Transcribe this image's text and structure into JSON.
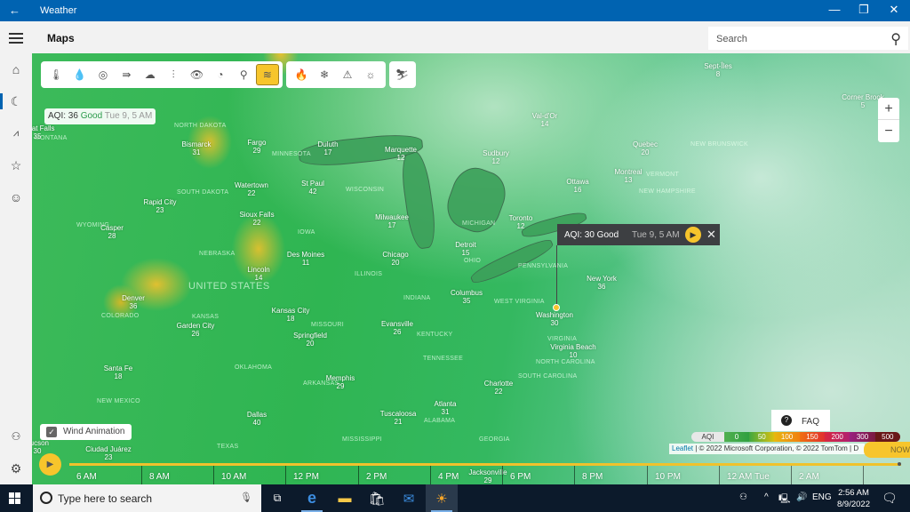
{
  "window": {
    "title": "Weather",
    "back_icon": "←",
    "minimize": "—",
    "restore": "❐",
    "close": "✕"
  },
  "header": {
    "page_title": "Maps",
    "search_placeholder": "Search"
  },
  "leftnav": {
    "items": [
      {
        "name": "home",
        "icon": "⌂"
      },
      {
        "name": "maps",
        "icon": "☾",
        "selected": true
      },
      {
        "name": "historical-weather",
        "icon": "📈"
      },
      {
        "name": "favorite-places",
        "icon": "☆"
      },
      {
        "name": "life",
        "icon": "☺"
      }
    ],
    "bottom": [
      {
        "name": "account",
        "icon": "👤"
      },
      {
        "name": "settings",
        "icon": "⚙"
      }
    ]
  },
  "toolbar": {
    "group1": [
      {
        "name": "temperature",
        "icon": "🌡"
      },
      {
        "name": "precipitation",
        "icon": "💧"
      },
      {
        "name": "radar",
        "icon": "◎"
      },
      {
        "name": "wind",
        "icon": "⇛"
      },
      {
        "name": "cloud",
        "icon": "☁"
      },
      {
        "name": "humidity",
        "icon": "⫶💧"
      },
      {
        "name": "visibility",
        "icon": "👁"
      },
      {
        "name": "pressure",
        "icon": "◔"
      },
      {
        "name": "pollen",
        "icon": "♠"
      },
      {
        "name": "air-quality",
        "icon": "≋",
        "selected": true
      }
    ],
    "group2": [
      {
        "name": "wildfire",
        "icon": "🔥"
      },
      {
        "name": "snow",
        "icon": "❄"
      },
      {
        "name": "severe-weather",
        "icon": "⚠"
      },
      {
        "name": "hurricane",
        "icon": "☼"
      }
    ],
    "group3": [
      {
        "name": "ski",
        "icon": "⛷"
      }
    ]
  },
  "aqi_label": {
    "prefix": "AQI: 36",
    "status": "Good",
    "time": "Tue 9, 5 AM"
  },
  "popup": {
    "aqi": "AQI: 30 Good",
    "time": "Tue 9, 5 AM",
    "play_icon": "▶",
    "close_icon": "✕"
  },
  "zoom": {
    "in": "+",
    "out": "−"
  },
  "wind_animation": {
    "label": "Wind Animation",
    "checked": true
  },
  "faq": {
    "label": "FAQ",
    "icon": "?"
  },
  "legend": {
    "title": "AQI",
    "stops": [
      {
        "label": "0",
        "color": "#3aa83a"
      },
      {
        "label": "50",
        "color": "#a8c820"
      },
      {
        "label": "100",
        "color": "#f0a010"
      },
      {
        "label": "150",
        "color": "#e85020"
      },
      {
        "label": "200",
        "color": "#c02050"
      },
      {
        "label": "300",
        "color": "#8a1a7a"
      },
      {
        "label": "500",
        "color": "#6a1818"
      }
    ]
  },
  "attribution": {
    "leaflet": "Leaflet",
    "text": " | © 2022 Microsoft Corporation, © 2022 TomTom | D"
  },
  "timeline": {
    "now_label": "NOW",
    "ticks": [
      "6 AM",
      "8 AM",
      "10 AM",
      "12 PM",
      "2 PM",
      "4 PM",
      "6 PM",
      "8 PM",
      "10 PM",
      "12 AM Tue",
      "2 AM"
    ]
  },
  "map": {
    "country": "UNITED STATES",
    "states": [
      "NORTH DAKOTA",
      "SOUTH DAKOTA",
      "MINNESOTA",
      "WISCONSIN",
      "MONTANA",
      "WYOMING",
      "NEBRASKA",
      "IOWA",
      "ILLINOIS",
      "INDIANA",
      "OHIO",
      "MICHIGAN",
      "PENNSYLVANIA",
      "KANSAS",
      "MISSOURI",
      "KENTUCKY",
      "TENNESSEE",
      "OKLAHOMA",
      "ARKANSAS",
      "TEXAS",
      "MISSISSIPPI",
      "ALABAMA",
      "GEORGIA",
      "SOUTH CAROLINA",
      "NORTH CAROLINA",
      "VIRGINIA",
      "WEST VIRGINIA",
      "COLORADO",
      "NEW MEXICO",
      "VERMONT",
      "NEW HAMPSHIRE",
      "NEW BRUNSWICK"
    ],
    "cities": [
      {
        "name": "Bismarck",
        "aqi": "31"
      },
      {
        "name": "Fargo",
        "aqi": "29"
      },
      {
        "name": "Duluth",
        "aqi": "17"
      },
      {
        "name": "Marquette",
        "aqi": "12"
      },
      {
        "name": "Sudbury",
        "aqi": "12"
      },
      {
        "name": "Val-d'Or",
        "aqi": "14"
      },
      {
        "name": "Quebec",
        "aqi": "20"
      },
      {
        "name": "Montreal",
        "aqi": "13"
      },
      {
        "name": "Ottawa",
        "aqi": "16"
      },
      {
        "name": "Sept-Îles",
        "aqi": "8"
      },
      {
        "name": "Corner Brook",
        "aqi": "5"
      },
      {
        "name": "Watertown",
        "aqi": "22"
      },
      {
        "name": "St Paul",
        "aqi": "42"
      },
      {
        "name": "Rapid City",
        "aqi": "23"
      },
      {
        "name": "Sioux Falls",
        "aqi": "22"
      },
      {
        "name": "Milwaukee",
        "aqi": "17"
      },
      {
        "name": "Toronto",
        "aqi": "12"
      },
      {
        "name": "Casper",
        "aqi": "28"
      },
      {
        "name": "Detroit",
        "aqi": "15"
      },
      {
        "name": "Des Moines",
        "aqi": "11"
      },
      {
        "name": "Chicago",
        "aqi": "20"
      },
      {
        "name": "Lincoln",
        "aqi": "14"
      },
      {
        "name": "New York",
        "aqi": "36"
      },
      {
        "name": "Columbus",
        "aqi": "35"
      },
      {
        "name": "Denver",
        "aqi": "36"
      },
      {
        "name": "Kansas City",
        "aqi": "18"
      },
      {
        "name": "Washington",
        "aqi": "30"
      },
      {
        "name": "Garden City",
        "aqi": "26"
      },
      {
        "name": "Springfield",
        "aqi": "20"
      },
      {
        "name": "Evansville",
        "aqi": "26"
      },
      {
        "name": "Virginia Beach",
        "aqi": "10"
      },
      {
        "name": "Santa Fe",
        "aqi": "18"
      },
      {
        "name": "Memphis",
        "aqi": "29"
      },
      {
        "name": "Charlotte",
        "aqi": "22"
      },
      {
        "name": "Atlanta",
        "aqi": "31"
      },
      {
        "name": "Tuscaloosa",
        "aqi": "21"
      },
      {
        "name": "Dallas",
        "aqi": "40"
      },
      {
        "name": "Ciudad Juárez",
        "aqi": "23"
      },
      {
        "name": "Great Falls",
        "aqi": "35"
      },
      {
        "name": "Tucson",
        "aqi": "30"
      },
      {
        "name": "Jacksonville",
        "aqi": "29"
      }
    ]
  },
  "taskbar": {
    "search_placeholder": "Type here to search",
    "apps": [
      "task-view",
      "edge",
      "file-explorer",
      "store",
      "mail",
      "weather"
    ],
    "tray": {
      "lang": "ENG",
      "time": "2:56 AM",
      "date": "8/9/2022",
      "notifications": "1"
    }
  }
}
